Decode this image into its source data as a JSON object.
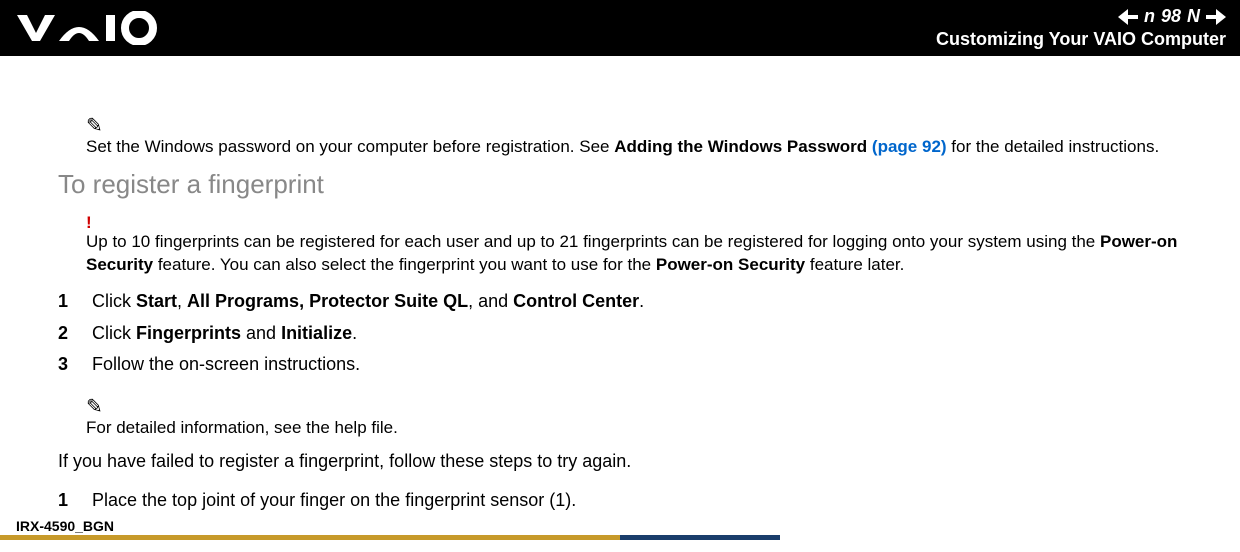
{
  "header": {
    "page_number": "98",
    "n_label": "n",
    "N_label": "N",
    "title": "Customizing Your VAIO Computer"
  },
  "content": {
    "note1_prefix": "Set the Windows password on your computer before registration. See ",
    "note1_bold": "Adding the Windows Password ",
    "note1_link": "(page 92)",
    "note1_suffix": " for the detailed instructions.",
    "heading": "To register a fingerprint",
    "warn_prefix": "Up to 10 fingerprints can be registered for each user and up to 21 fingerprints can be registered for logging onto your system using the ",
    "warn_bold1": "Power-on Security",
    "warn_mid": " feature. You can also select the fingerprint you want to use for the ",
    "warn_bold2": "Power-on Security",
    "warn_suffix": " feature later.",
    "steps1": [
      {
        "num": "1",
        "pre": "Click ",
        "b1": "Start",
        "mid1": ", ",
        "b2": "All Programs, Protector Suite QL",
        "mid2": ", and ",
        "b3": "Control Center",
        "post": "."
      },
      {
        "num": "2",
        "pre": "Click ",
        "b1": "Fingerprints",
        "mid1": " and ",
        "b2": "Initialize",
        "mid2": "",
        "b3": "",
        "post": "."
      },
      {
        "num": "3",
        "pre": "Follow the on-screen instructions.",
        "b1": "",
        "mid1": "",
        "b2": "",
        "mid2": "",
        "b3": "",
        "post": ""
      }
    ],
    "note2": "For detailed information, see the help file.",
    "body1": "If you have failed to register a fingerprint, follow these steps to try again.",
    "steps2": [
      {
        "num": "1",
        "text": "Place the top joint of your finger on the fingerprint sensor (1)."
      }
    ]
  },
  "footer": {
    "code": "IRX-4590_BGN"
  }
}
